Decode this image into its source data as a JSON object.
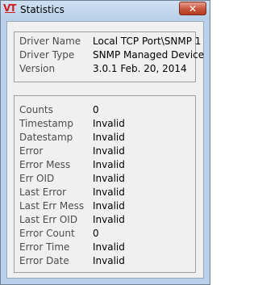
{
  "window": {
    "logo_text": "VT",
    "title": "Statistics",
    "close_glyph": "✕"
  },
  "driver_info": [
    {
      "label": "Driver Name",
      "value": "Local TCP Port\\SNMP 1"
    },
    {
      "label": "Driver Type",
      "value": "SNMP Managed Device"
    },
    {
      "label": "Version",
      "value": "3.0.1 Feb. 20, 2014"
    }
  ],
  "stats": [
    {
      "label": "Counts",
      "value": "0"
    },
    {
      "label": "Timestamp",
      "value": "Invalid"
    },
    {
      "label": "Datestamp",
      "value": "Invalid"
    },
    {
      "label": "Error",
      "value": "Invalid"
    },
    {
      "label": "Error Mess",
      "value": "Invalid"
    },
    {
      "label": "Err OID",
      "value": "Invalid"
    },
    {
      "label": "Last Error",
      "value": "Invalid"
    },
    {
      "label": "Last Err Mess",
      "value": "Invalid"
    },
    {
      "label": "Last Err OID",
      "value": "Invalid"
    },
    {
      "label": "Error Count",
      "value": "0"
    },
    {
      "label": "Error Time",
      "value": "Invalid"
    },
    {
      "label": "Error Date",
      "value": "Invalid"
    }
  ],
  "colors": {
    "title_bar": "#bcd3eb",
    "close_button": "#c7533b",
    "logo": "#d31c1c",
    "client_background": "#f0f0f0",
    "label_text": "#4c4c4c",
    "value_text": "#000000"
  }
}
